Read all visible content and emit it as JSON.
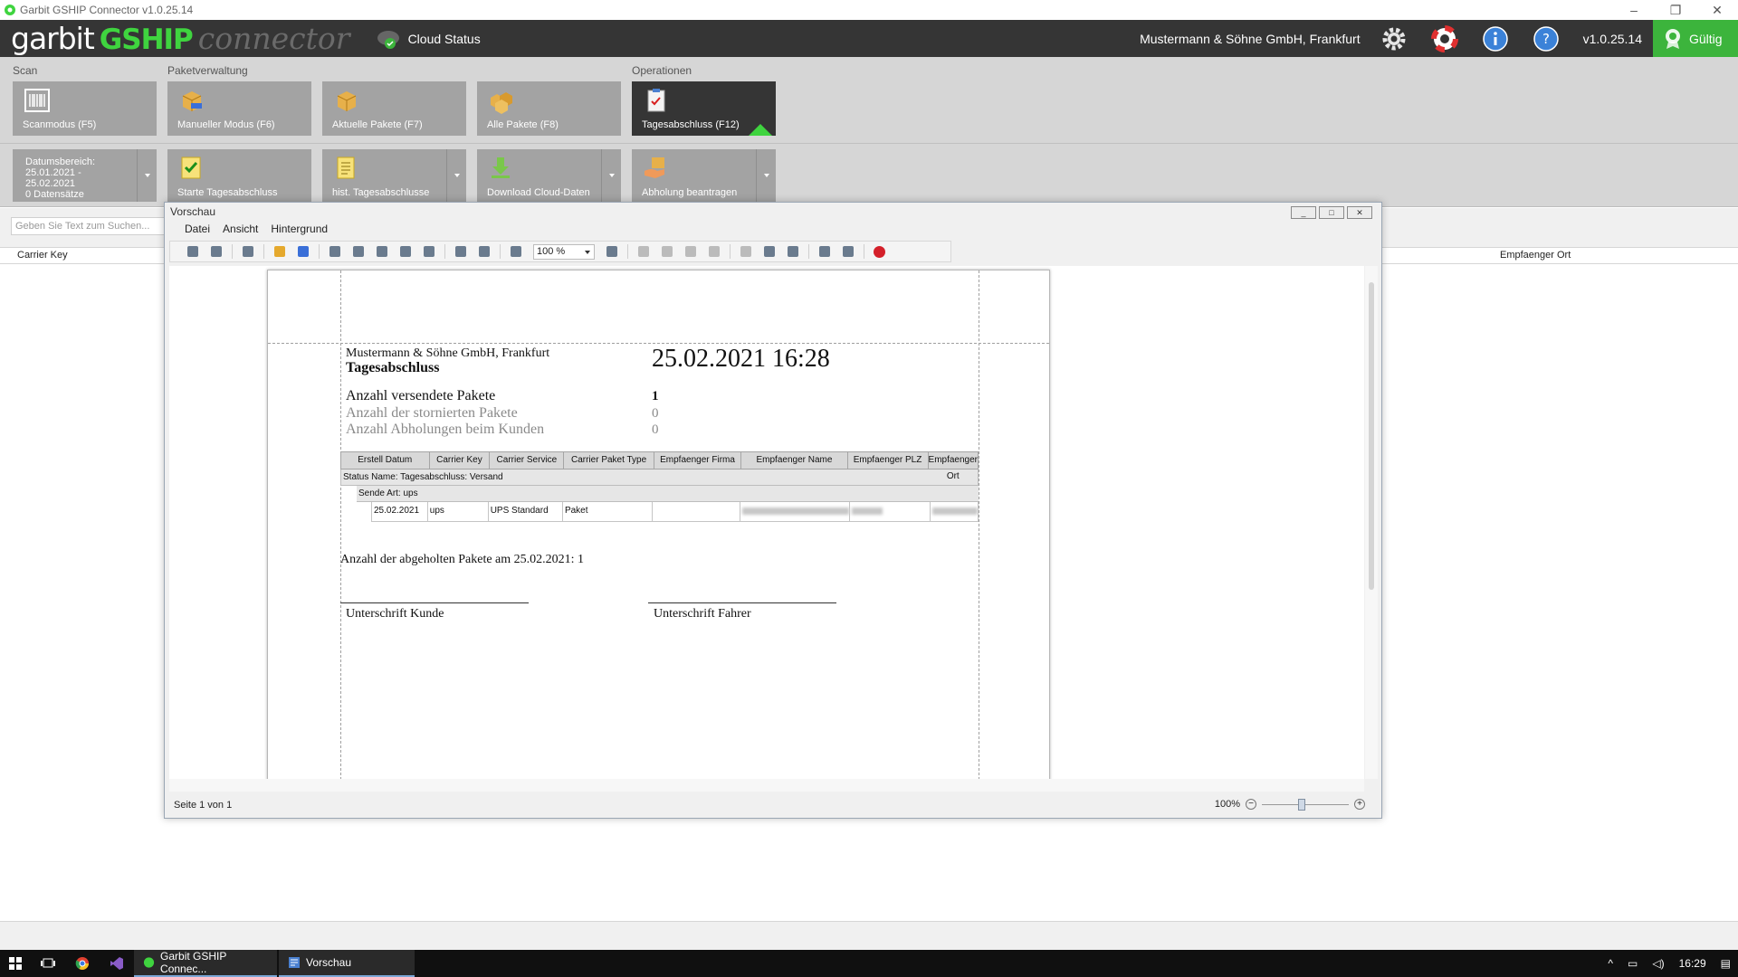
{
  "window": {
    "title": "Garbit GSHIP Connector v1.0.25.14"
  },
  "header": {
    "brand_garbit": "garbit",
    "brand_gship": "GSHIP",
    "brand_connector": "connector",
    "cloud_status": "Cloud Status",
    "company": "Mustermann & Söhne GmbH, Frankfurt",
    "version": "v1.0.25.14",
    "license": "Gültig",
    "colors": {
      "header_bg": "#353535",
      "brand_green": "#3fd43f",
      "valid_bg": "#3cb43c"
    }
  },
  "ribbon": {
    "groups": {
      "scan": "Scan",
      "paket": "Paketverwaltung",
      "ops": "Operationen"
    },
    "buttons": {
      "scan": "Scanmodus (F5)",
      "manual": "Manueller Modus (F6)",
      "current": "Aktuelle Pakete (F7)",
      "all": "Alle Pakete (F8)",
      "eod": "Tagesabschluss (F12)"
    },
    "row2": {
      "date_line1": "Datumsbereich:",
      "date_line2": "25.01.2021 -",
      "date_line3": "25.02.2021",
      "date_line4": "0 Datensätze",
      "start": "Starte Tagesabschluss",
      "hist": "hist. Tagesabschlusse",
      "download": "Download Cloud-Daten",
      "pickup": "Abholung beantragen"
    }
  },
  "main": {
    "search_placeholder": "Geben Sie Text zum Suchen...",
    "col_carrier_key": "Carrier Key",
    "col_empf_ort": "Empfaenger Ort"
  },
  "preview": {
    "title": "Vorschau",
    "menu": [
      "Datei",
      "Ansicht",
      "Hintergrund"
    ],
    "zoom_value": "100 %",
    "status_page": "Seite 1 von 1",
    "zoom_percent": "100%",
    "zoom_minus": "−",
    "zoom_plus": "+"
  },
  "report": {
    "company": "Mustermann & Söhne GmbH, Frankfurt",
    "title": "Tagesabschluss",
    "datetime": "25.02.2021 16:28",
    "rows": [
      {
        "label": "Anzahl versendete Pakete",
        "value": "1"
      },
      {
        "label": "Anzahl der stornierten Pakete",
        "value": "0"
      },
      {
        "label": "Anzahl Abholungen beim Kunden",
        "value": "0"
      }
    ],
    "table": {
      "headers": [
        "Erstell Datum",
        "Carrier Key",
        "Carrier Service",
        "Carrier Paket Type",
        "Empfaenger Firma",
        "Empfaenger Name",
        "Empfaenger PLZ",
        "Empfaenger Ort"
      ],
      "group1": "Status Name: Tagesabschluss: Versand",
      "group2": "Sende Art: ups",
      "row": [
        "25.02.2021",
        "ups",
        "UPS Standard",
        "Paket",
        ""
      ]
    },
    "pickup_text": "Anzahl der abgeholten Pakete am 25.02.2021: 1",
    "sig_customer": "Unterschrift Kunde",
    "sig_driver": "Unterschrift Fahrer"
  },
  "taskbar": {
    "app1": "Garbit GSHIP Connec...",
    "app2": "Vorschau",
    "time": "16:29"
  }
}
